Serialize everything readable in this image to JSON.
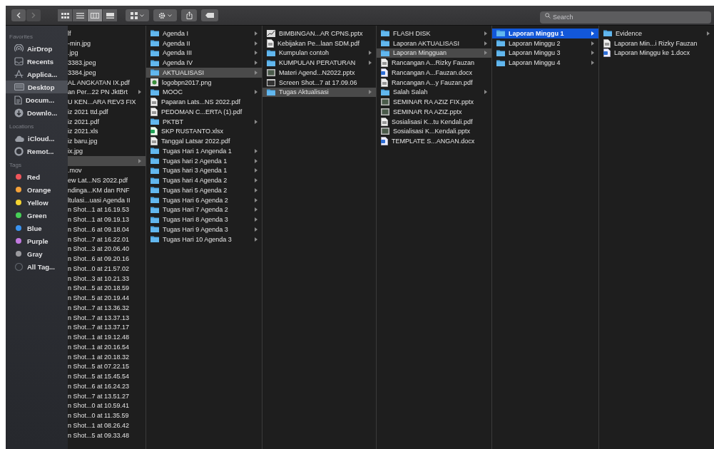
{
  "toolbar": {
    "view_modes": [
      {
        "kind": "icons",
        "selected": false
      },
      {
        "kind": "list",
        "selected": false
      },
      {
        "kind": "columns",
        "selected": true
      },
      {
        "kind": "gallery",
        "selected": false
      }
    ],
    "search": {
      "placeholder": "Search"
    }
  },
  "sidebar": {
    "sections": [
      {
        "title": "Favorites",
        "items": [
          {
            "label": "AirDrop",
            "selected": false
          },
          {
            "label": "Recents",
            "selected": false
          },
          {
            "label": "Applica...",
            "selected": false
          },
          {
            "label": "Desktop",
            "selected": true
          },
          {
            "label": "Docum...",
            "selected": false
          },
          {
            "label": "Downlo...",
            "selected": false
          }
        ]
      },
      {
        "title": "Locations",
        "items": [
          {
            "label": "iCloud...",
            "selected": false
          },
          {
            "label": "Remot...",
            "selected": false
          }
        ]
      },
      {
        "title": "Tags",
        "items": [
          {
            "label": "Red",
            "color": "#f0565b",
            "selected": false
          },
          {
            "label": "Orange",
            "color": "#f4a23a",
            "selected": false
          },
          {
            "label": "Yellow",
            "color": "#f5d431",
            "selected": false
          },
          {
            "label": "Green",
            "color": "#47cf57",
            "selected": false
          },
          {
            "label": "Blue",
            "color": "#3a93f0",
            "selected": false
          },
          {
            "label": "Purple",
            "color": "#c27ae0",
            "selected": false
          },
          {
            "label": "Gray",
            "color": "#9a9a9e",
            "selected": false
          },
          {
            "label": "All Tag...",
            "selected": false
          }
        ]
      }
    ]
  },
  "columns": [
    {
      "focused": false,
      "items": [
        {
          "name": "lf",
          "kind": "name",
          "selected": false
        },
        {
          "name": "-min.jpg",
          "kind": "name",
          "selected": false
        },
        {
          "name": ".jpg",
          "kind": "name",
          "selected": false
        },
        {
          "name": "3383.jpeg",
          "kind": "name",
          "selected": false
        },
        {
          "name": "3384.jpeg",
          "kind": "name",
          "selected": false
        },
        {
          "name": "AL ANGKATAN IX.pdf",
          "kind": "name",
          "selected": false
        },
        {
          "name": "an Per...22 PN JktBrt",
          "kind": "subfolder",
          "selected": false
        },
        {
          "name": "U KEN...ARA REV3 FIX",
          "kind": "name",
          "selected": false
        },
        {
          "name": "iz 2021 ttd.pdf",
          "kind": "name",
          "selected": false
        },
        {
          "name": "iz 2021.pdf",
          "kind": "name",
          "selected": false
        },
        {
          "name": "iz 2021.xls",
          "kind": "name",
          "selected": false
        },
        {
          "name": "iz baru.jpg",
          "kind": "name",
          "selected": false
        },
        {
          "name": "ix.jpg",
          "kind": "name",
          "selected": false
        },
        {
          "kind": "subfolder",
          "selected": true
        },
        {
          "name": ".mov",
          "kind": "name",
          "selected": false
        },
        {
          "name": "ew Lat...NS 2022.pdf",
          "kind": "name",
          "selected": false
        },
        {
          "name": "ndinga...KM dan RNF",
          "kind": "name",
          "selected": false
        },
        {
          "name": "ltulasi...uasi Agenda II",
          "kind": "name",
          "selected": false
        },
        {
          "name": "n Shot...1 at 16.19.53",
          "kind": "name",
          "selected": false
        },
        {
          "name": "n Shot...1 at 09.19.13",
          "kind": "name",
          "selected": false
        },
        {
          "name": "n Shot...6 at 09.18.04",
          "kind": "name",
          "selected": false
        },
        {
          "name": "n Shot...7 at 16.22.01",
          "kind": "name",
          "selected": false
        },
        {
          "name": "n Shot...3 at 20.06.40",
          "kind": "name",
          "selected": false
        },
        {
          "name": "n Shot...6 at 09.20.16",
          "kind": "name",
          "selected": false
        },
        {
          "name": "n Shot...0 at 21.57.02",
          "kind": "name",
          "selected": false
        },
        {
          "name": "n Shot...3 at 10.21.33",
          "kind": "name",
          "selected": false
        },
        {
          "name": "n Shot...5 at 20.18.59",
          "kind": "name",
          "selected": false
        },
        {
          "name": "n Shot...5 at 20.19.44",
          "kind": "name",
          "selected": false
        },
        {
          "name": "n Shot...7 at 13.36.32",
          "kind": "name",
          "selected": false
        },
        {
          "name": "n Shot...7 at 13.37.13",
          "kind": "name",
          "selected": false
        },
        {
          "name": "n Shot...7 at 13.37.17",
          "kind": "name",
          "selected": false
        },
        {
          "name": "n Shot...1 at 19.12.48",
          "kind": "name",
          "selected": false
        },
        {
          "name": "n Shot...1 at 20.16.54",
          "kind": "name",
          "selected": false
        },
        {
          "name": "n Shot...1 at 20.18.32",
          "kind": "name",
          "selected": false
        },
        {
          "name": "n Shot...5 at 07.22.15",
          "kind": "name",
          "selected": false
        },
        {
          "name": "n Shot...5 at 15.45.54",
          "kind": "name",
          "selected": false
        },
        {
          "name": "n Shot...6 at 16.24.23",
          "kind": "name",
          "selected": false
        },
        {
          "name": "n Shot...7 at 13.51.27",
          "kind": "name",
          "selected": false
        },
        {
          "name": "n Shot...0 at 10.59.41",
          "kind": "name",
          "selected": false
        },
        {
          "name": "n Shot...0 at 11.35.59",
          "kind": "name",
          "selected": false
        },
        {
          "name": "n Shot...1 at 08.26.42",
          "kind": "name",
          "selected": false
        },
        {
          "name": "n Shot...5 at 09.33.48",
          "kind": "name",
          "selected": false
        }
      ]
    },
    {
      "focused": false,
      "items": [
        {
          "name": "Agenda I",
          "kind": "folder",
          "selected": false
        },
        {
          "name": "Agenda II",
          "kind": "folder",
          "selected": false
        },
        {
          "name": "Agenda III",
          "kind": "folder",
          "selected": false
        },
        {
          "name": "Agenda IV",
          "kind": "folder",
          "selected": false
        },
        {
          "name": "AKTUALISASI",
          "kind": "folder",
          "selected": true
        },
        {
          "name": "logobpn2017.png",
          "kind": "image",
          "selected": false
        },
        {
          "name": "MOOC",
          "kind": "folder",
          "selected": false
        },
        {
          "name": "Paparan Lats...NS 2022.pdf",
          "kind": "pdf",
          "selected": false
        },
        {
          "name": "PEDOMAN C...ERTA (1).pdf",
          "kind": "pdf",
          "selected": false
        },
        {
          "name": "PKTBT",
          "kind": "folder",
          "selected": false
        },
        {
          "name": "SKP RUSTANTO.xlsx",
          "kind": "sheet",
          "selected": false
        },
        {
          "name": "Tanggal Latsar 2022.pdf",
          "kind": "pdf",
          "selected": false
        },
        {
          "name": "Tugas Hari 1 Angenda 1",
          "kind": "folder",
          "selected": false
        },
        {
          "name": "Tugas hari 2 Agenda 1",
          "kind": "folder",
          "selected": false
        },
        {
          "name": "Tugas hari 3 Agenda 1",
          "kind": "folder",
          "selected": false
        },
        {
          "name": "Tugas hari 4 Agenda 2",
          "kind": "folder",
          "selected": false
        },
        {
          "name": "Tugas hari 5 Agenda 2",
          "kind": "folder",
          "selected": false
        },
        {
          "name": "Tugas Hari 6 Agenda 2",
          "kind": "folder",
          "selected": false
        },
        {
          "name": "Tugas Hari 7 Agenda 2",
          "kind": "folder",
          "selected": false
        },
        {
          "name": "Tugas Hari 8 Agenda 3",
          "kind": "folder",
          "selected": false
        },
        {
          "name": "Tugas Hari 9 Agenda 3",
          "kind": "folder",
          "selected": false
        },
        {
          "name": "Tugas Hari 10 Agenda 3",
          "kind": "folder",
          "selected": false
        }
      ]
    },
    {
      "focused": false,
      "items": [
        {
          "name": "BIMBINGAN...AR CPNS.pptx",
          "kind": "chart",
          "selected": false
        },
        {
          "name": "Kebijakan Pe...laan SDM.pdf",
          "kind": "pdf",
          "selected": false
        },
        {
          "name": "Kumpulan contoh",
          "kind": "folder",
          "selected": false
        },
        {
          "name": "KUMPULAN PERATURAN",
          "kind": "folder",
          "selected": false
        },
        {
          "name": "Materi Agend...N2022.pptx",
          "kind": "slide",
          "selected": false
        },
        {
          "name": "Screen Shot...7 at 17.09.06",
          "kind": "screenshot",
          "selected": false
        },
        {
          "name": "Tugas Aktualisasi",
          "kind": "folder",
          "selected": true
        }
      ]
    },
    {
      "focused": false,
      "items": [
        {
          "name": "FLASH DISK",
          "kind": "folder",
          "selected": false
        },
        {
          "name": "Laporan AKTUALISASI",
          "kind": "folder",
          "selected": false
        },
        {
          "name": "Laporan Mingguan",
          "kind": "folder",
          "selected": true
        },
        {
          "name": "Rancangan A...Rizky Fauzan",
          "kind": "pdf",
          "selected": false
        },
        {
          "name": "Rancangan A...Fauzan.docx",
          "kind": "word",
          "selected": false
        },
        {
          "name": "Rancangan A...y Fauzan.pdf",
          "kind": "pdf",
          "selected": false
        },
        {
          "name": "Salah Salah",
          "kind": "folder",
          "selected": false
        },
        {
          "name": "SEMINAR RA AZIZ FIX.pptx",
          "kind": "slide",
          "selected": false
        },
        {
          "name": "SEMINAR RA AZIZ.pptx",
          "kind": "slide",
          "selected": false
        },
        {
          "name": "Sosialisasi K...tu Kendali.pdf",
          "kind": "pdf",
          "selected": false
        },
        {
          "name": "Sosialisasi K...Kendali.pptx",
          "kind": "slide",
          "selected": false
        },
        {
          "name": "TEMPLATE S...ANGAN.docx",
          "kind": "word",
          "selected": false
        }
      ]
    },
    {
      "focused": true,
      "items": [
        {
          "name": "Laporan Minggu 1",
          "kind": "folder",
          "selected": true
        },
        {
          "name": "Laporan Minggu 2",
          "kind": "folder",
          "selected": false
        },
        {
          "name": "Laporan Minggu 3",
          "kind": "folder",
          "selected": false
        },
        {
          "name": "Laporan Minggu 4",
          "kind": "folder",
          "selected": false
        }
      ]
    },
    {
      "items": [
        {
          "name": "Evidence",
          "kind": "folder",
          "selected": false
        },
        {
          "name": "Laporan Min...i Rizky Fauzan",
          "kind": "pdf",
          "selected": false
        },
        {
          "name": "Laporan Minggu ke 1.docx",
          "kind": "word",
          "selected": false
        }
      ]
    }
  ]
}
